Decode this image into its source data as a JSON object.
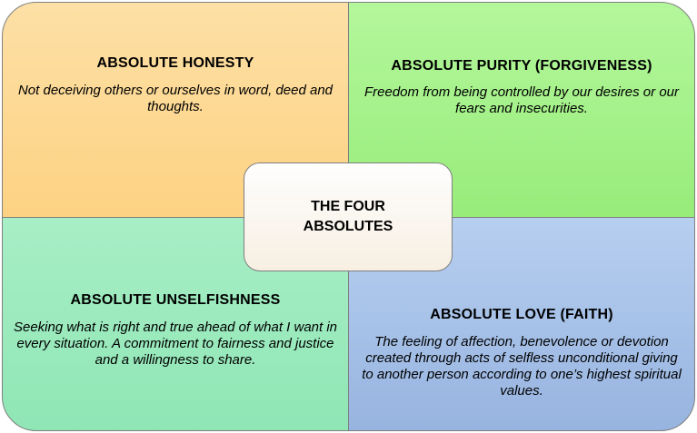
{
  "center": {
    "title": "THE FOUR ABSOLUTES"
  },
  "quadrants": {
    "honesty": {
      "title": "ABSOLUTE HONESTY",
      "description": "Not deceiving others or ourselves in word, deed and thoughts.",
      "color": "#fdd283"
    },
    "purity": {
      "title": "ABSOLUTE PURITY (FORGIVENESS)",
      "description": "Freedom from being controlled by our desires or our fears and insecurities.",
      "color": "#97ec7a"
    },
    "unselfishness": {
      "title": "ABSOLUTE UNSELFISHNESS",
      "description": "Seeking what is right and true ahead of what I want in every situation. A commitment to fairness and justice and a willingness to share.",
      "color": "#8fe6b5"
    },
    "love": {
      "title": "ABSOLUTE LOVE (FAITH)",
      "description": "The feeling of affection, benevolence or devotion created through acts of selfless unconditional giving to another person according to one’s highest spiritual values.",
      "color": "#97b4e0"
    }
  }
}
